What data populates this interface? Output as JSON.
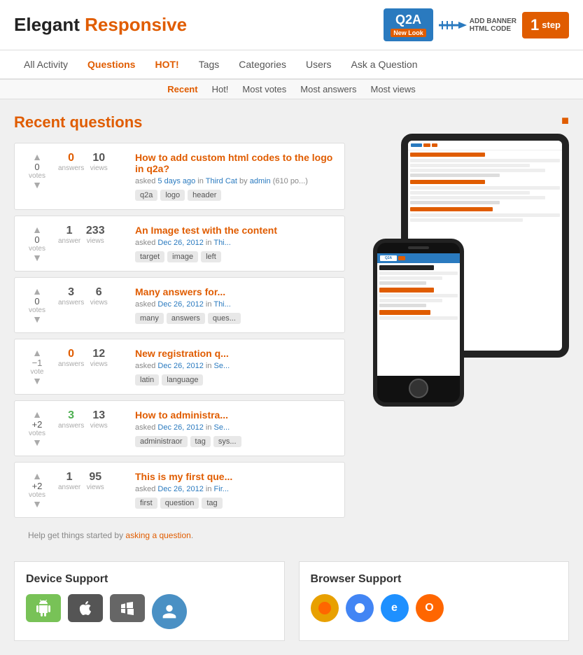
{
  "header": {
    "logo": {
      "elegant": "Elegant",
      "responsive": "Responsive"
    },
    "ad": {
      "q2a": "Q2A",
      "newLook": "New Look",
      "addBanner": "ADD BANNER",
      "htmlCode": "HTML CODE",
      "step": "step",
      "stepNum": "1"
    }
  },
  "nav": {
    "items": [
      {
        "label": "All Activity",
        "href": "#",
        "active": false
      },
      {
        "label": "Questions",
        "href": "#",
        "active": true
      },
      {
        "label": "HOT!",
        "href": "#",
        "hot": true
      },
      {
        "label": "Tags",
        "href": "#",
        "active": false
      },
      {
        "label": "Categories",
        "href": "#",
        "active": false
      },
      {
        "label": "Users",
        "href": "#",
        "active": false
      },
      {
        "label": "Ask a Question",
        "href": "#",
        "active": false
      }
    ]
  },
  "subnav": {
    "items": [
      {
        "label": "Recent",
        "active": true
      },
      {
        "label": "Hot!",
        "active": false
      },
      {
        "label": "Most votes",
        "active": false
      },
      {
        "label": "Most answers",
        "active": false
      },
      {
        "label": "Most views",
        "active": false
      }
    ]
  },
  "sectionTitle": {
    "prefix": "Recent ",
    "highlight": "questions"
  },
  "questions": [
    {
      "votes": "0",
      "votesLabel": "votes",
      "answers": "0",
      "answersLabel": "answers",
      "answersOrange": true,
      "views": "10",
      "viewsLabel": "views",
      "title": "How to add custom html codes to the logo in q2a?",
      "meta": "asked 5 days ago in Third Cat by admin (610 po...",
      "tags": [
        "q2a",
        "logo",
        "header"
      ]
    },
    {
      "votes": "0",
      "votesLabel": "votes",
      "answers": "1",
      "answersLabel": "answer",
      "answersOrange": false,
      "views": "233",
      "viewsLabel": "views",
      "title": "An Image test with the content",
      "meta": "asked Dec 26, 2012 in Thi...",
      "tags": [
        "target",
        "image",
        "left"
      ]
    },
    {
      "votes": "0",
      "votesLabel": "votes",
      "answers": "3",
      "answersLabel": "answers",
      "answersOrange": false,
      "views": "6",
      "viewsLabel": "views",
      "title": "Many answers for...",
      "meta": "asked Dec 26, 2012 in Thi...",
      "tags": [
        "many",
        "answers",
        "ques..."
      ]
    },
    {
      "votes": "−1",
      "votesLabel": "vote",
      "answers": "0",
      "answersLabel": "answers",
      "answersOrange": true,
      "views": "12",
      "viewsLabel": "views",
      "title": "New registration q...",
      "meta": "asked Dec 26, 2012 in Se...",
      "tags": [
        "latin",
        "language"
      ]
    },
    {
      "votes": "+2",
      "votesLabel": "votes",
      "answers": "3",
      "answersLabel": "answers",
      "answersOrange": false,
      "answersGreen": true,
      "views": "13",
      "viewsLabel": "views",
      "title": "How to administra...",
      "meta": "asked Dec 26, 2012 in Se...",
      "tags": [
        "administraor",
        "tag",
        "sys..."
      ]
    },
    {
      "votes": "+2",
      "votesLabel": "votes",
      "answers": "1",
      "answersLabel": "answer",
      "answersOrange": false,
      "answersGreen": false,
      "views": "95",
      "viewsLabel": "views",
      "title": "This is my first que...",
      "meta": "asked Dec 26, 2012 in Fir...",
      "tags": [
        "first",
        "question",
        "tag"
      ]
    }
  ],
  "helpText": "Help get things started by asking a question.",
  "helpLinkText": "asking a question",
  "deviceSupport": {
    "title": "Device Support"
  },
  "browserSupport": {
    "title": "Browser Support"
  }
}
